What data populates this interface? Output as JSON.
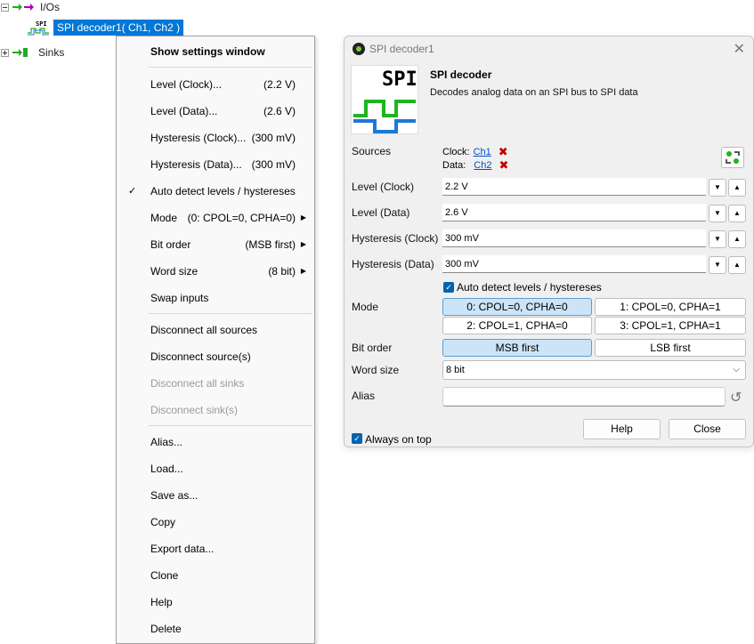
{
  "tree": {
    "ios_label": "I/Os",
    "device_icon_text": "SPI",
    "selected_label": "SPI decoder1( Ch1, Ch2 )",
    "sinks_label": "Sinks"
  },
  "context_menu": {
    "items": [
      {
        "label": "Show settings window",
        "value": "",
        "bold": true
      },
      {
        "label": "Level (Clock)...",
        "value": "(2.2 V)"
      },
      {
        "label": "Level (Data)...",
        "value": "(2.6 V)"
      },
      {
        "label": "Hysteresis (Clock)...",
        "value": "(300 mV)"
      },
      {
        "label": "Hysteresis (Data)...",
        "value": "(300 mV)"
      },
      {
        "label": "Auto detect levels / hystereses",
        "value": "",
        "checked": true
      },
      {
        "label": "Mode",
        "value": "(0: CPOL=0, CPHA=0)",
        "submenu": true
      },
      {
        "label": "Bit order",
        "value": "(MSB first)",
        "submenu": true
      },
      {
        "label": "Word size",
        "value": "(8 bit)",
        "submenu": true
      },
      {
        "label": "Swap inputs",
        "value": ""
      },
      {
        "label": "Disconnect all sources",
        "value": ""
      },
      {
        "label": "Disconnect source(s)",
        "value": ""
      },
      {
        "label": "Disconnect all sinks",
        "value": "",
        "disabled": true
      },
      {
        "label": "Disconnect sink(s)",
        "value": "",
        "disabled": true
      },
      {
        "label": "Alias...",
        "value": ""
      },
      {
        "label": "Load...",
        "value": ""
      },
      {
        "label": "Save as...",
        "value": ""
      },
      {
        "label": "Copy",
        "value": ""
      },
      {
        "label": "Export data...",
        "value": ""
      },
      {
        "label": "Clone",
        "value": ""
      },
      {
        "label": "Help",
        "value": ""
      },
      {
        "label": "Delete",
        "value": ""
      }
    ]
  },
  "dialog": {
    "title": "SPI decoder1",
    "logo_text": "SPI",
    "header_title": "SPI decoder",
    "header_desc": "Decodes analog data on an SPI bus to SPI data",
    "sources_label": "Sources",
    "clock_prefix": "Clock:",
    "clock_link": "Ch1",
    "data_prefix": "Data:",
    "data_link": "Ch2",
    "level_clock_label": "Level (Clock)",
    "level_clock_value": "2.2 V",
    "level_data_label": "Level (Data)",
    "level_data_value": "2.6 V",
    "hyst_clock_label": "Hysteresis (Clock)",
    "hyst_clock_value": "300 mV",
    "hyst_data_label": "Hysteresis (Data)",
    "hyst_data_value": "300 mV",
    "auto_detect_label": "Auto detect levels / hystereses",
    "mode_label": "Mode",
    "mode_options": [
      "0: CPOL=0, CPHA=0",
      "1: CPOL=0, CPHA=1",
      "2: CPOL=1, CPHA=0",
      "3: CPOL=1, CPHA=1"
    ],
    "mode_selected": 0,
    "bit_order_label": "Bit order",
    "bit_order_options": [
      "MSB first",
      "LSB first"
    ],
    "word_size_label": "Word size",
    "word_size_value": "8 bit",
    "alias_label": "Alias",
    "alias_value": "",
    "always_on_top_label": "Always on top",
    "help_button": "Help",
    "close_button": "Close"
  },
  "colors": {
    "selection": "#0078d7",
    "accent": "#0063b1",
    "link": "#0050c8",
    "delete_red": "#c00000",
    "logo_green": "#1fb51f",
    "logo_blue": "#1e78d8"
  },
  "icons": {
    "close": "close-icon",
    "swap": "swap-inputs-icon",
    "reset": "reset-icon",
    "spin_down": "spin-down-icon",
    "spin_up": "spin-up-icon"
  }
}
